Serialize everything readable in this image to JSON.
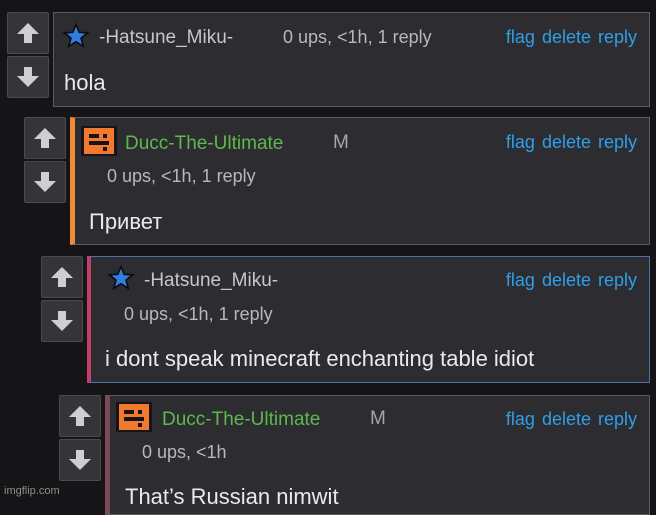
{
  "comments": [
    {
      "username": "-Hatsune_Miku-",
      "meta": "0 ups, <1h, 1 reply",
      "body": "hola",
      "actions": {
        "flag": "flag",
        "delete": "delete",
        "reply": "reply"
      },
      "avatar_icon": "star-icon"
    },
    {
      "username": "Ducc-The-Ultimate",
      "badge": "M",
      "meta": "0 ups, <1h, 1 reply",
      "body": "Привет",
      "actions": {
        "flag": "flag",
        "delete": "delete",
        "reply": "reply"
      },
      "avatar_icon": "pixel-face-icon"
    },
    {
      "username": "-Hatsune_Miku-",
      "meta": "0 ups, <1h, 1 reply",
      "body": "i dont speak minecraft enchanting table idiot",
      "actions": {
        "flag": "flag",
        "delete": "delete",
        "reply": "reply"
      },
      "avatar_icon": "star-icon"
    },
    {
      "username": "Ducc-The-Ultimate",
      "badge": "M",
      "meta": "0 ups, <1h",
      "body": "That’s Russian nimwit",
      "actions": {
        "flag": "flag",
        "delete": "delete",
        "reply": "reply"
      },
      "avatar_icon": "pixel-face-icon"
    }
  ],
  "icons": {
    "upvote": "arrow-up-icon",
    "downvote": "arrow-down-icon"
  },
  "colors": {
    "link": "#2f9fe8",
    "mod_name": "#5fb84d",
    "thread_orange": "#f08a34",
    "thread_pink": "#c0486e",
    "highlight_border": "#4f6fae"
  },
  "watermark": "imgflip.com"
}
